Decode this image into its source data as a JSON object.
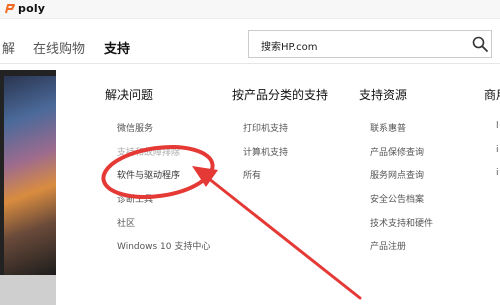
{
  "header": {
    "brand": "poly"
  },
  "nav": {
    "items": [
      {
        "label": "解"
      },
      {
        "label": "在线购物"
      },
      {
        "label": "支持",
        "active": true
      }
    ]
  },
  "search": {
    "placeholder": "搜索HP.com"
  },
  "menu": {
    "columns": [
      {
        "title": "解决问题",
        "links": [
          "微信服务",
          "支持和故障排除",
          "软件与驱动程序",
          "诊断工具",
          "社区",
          "Windows 10 支持中心"
        ]
      },
      {
        "title": "按产品分类的支持",
        "links": [
          "打印机支持",
          "计算机支持",
          "所有"
        ]
      },
      {
        "title": "支持资源",
        "links": [
          "联系惠普",
          "产品保修查询",
          "服务网点查询",
          "安全公告档案",
          "技术支持和硬件",
          "产品注册"
        ]
      },
      {
        "title": "商用"
      }
    ]
  },
  "colors": {
    "annotation_red": "#e53935",
    "brand_orange": "#f26a21"
  }
}
